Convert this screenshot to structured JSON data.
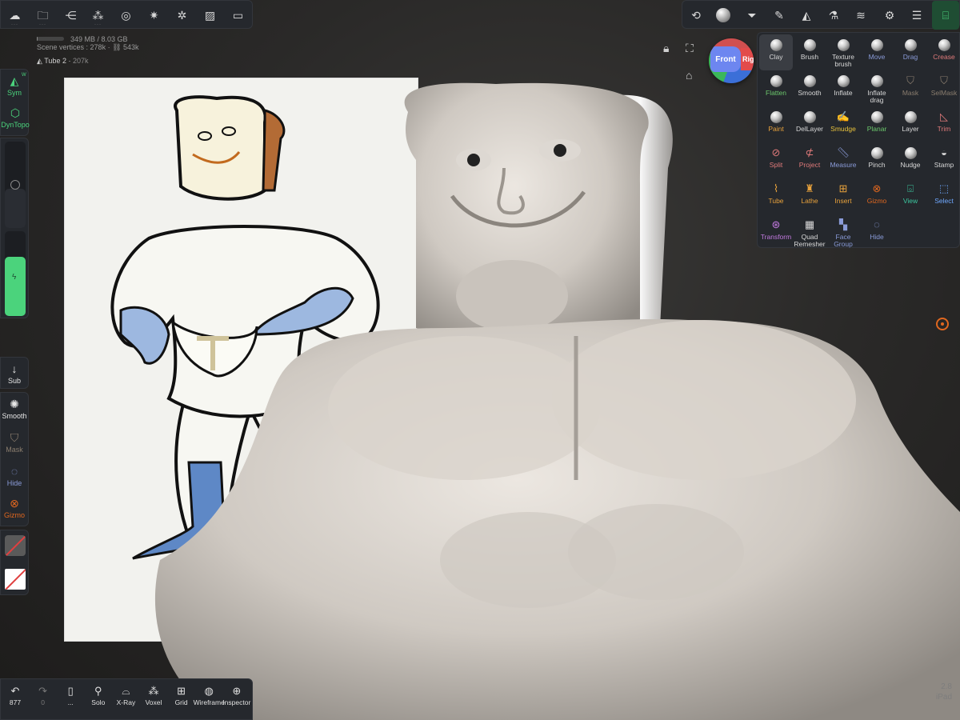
{
  "stats": {
    "memory": "349 MB / 8.03 GB",
    "memory_fraction": 0.04,
    "scene_vertices_label": "Scene vertices :",
    "scene_vertices": "278k",
    "scene_triangles": "543k",
    "object_name": "Tube 2",
    "object_vertices": "207k"
  },
  "top_left_icons": [
    "sketchfab-icon",
    "folder-icon",
    "share-nodes-icon",
    "cubes-icon",
    "globe-icon",
    "sun-icon",
    "aperture-icon",
    "image-icon",
    "camera-icon"
  ],
  "top_right_icons": [
    "cloud-sync-icon",
    "material-sphere-icon",
    "funnel-icon",
    "pen-icon",
    "triangle-icon",
    "flask-icon",
    "layers-icon",
    "settings-icon",
    "sliders-icon",
    "scene-tree-icon"
  ],
  "view_cube": {
    "front": "Front",
    "right": "Rig"
  },
  "tools": [
    {
      "label": "Clay",
      "icon": "ball",
      "color": "#d8d8d8",
      "selected": true
    },
    {
      "label": "Brush",
      "icon": "ball",
      "color": "#d8d8d8"
    },
    {
      "label": "Texture brush",
      "icon": "ball",
      "color": "#d8d8d8"
    },
    {
      "label": "Move",
      "icon": "ball",
      "color": "#8a9bd8"
    },
    {
      "label": "Drag",
      "icon": "ball",
      "color": "#8a9bd8"
    },
    {
      "label": "Crease",
      "icon": "ball",
      "color": "#e07a7a"
    },
    {
      "label": "Flatten",
      "icon": "ball",
      "color": "#6cc86c"
    },
    {
      "label": "Smooth",
      "icon": "ball",
      "color": "#d8d8d8"
    },
    {
      "label": "Inflate",
      "icon": "ball",
      "color": "#d8d8d8"
    },
    {
      "label": "Inflate drag",
      "icon": "ball",
      "color": "#d8d8d8"
    },
    {
      "label": "Mask",
      "icon": "shield",
      "color": "#8a7d6e"
    },
    {
      "label": "SelMask",
      "icon": "shield",
      "color": "#8a7d6e"
    },
    {
      "label": "Paint",
      "icon": "ball",
      "color": "#e8a23c"
    },
    {
      "label": "DelLayer",
      "icon": "ball",
      "color": "#d8d8d8"
    },
    {
      "label": "Smudge",
      "icon": "smudge",
      "color": "#e8c23c"
    },
    {
      "label": "Planar",
      "icon": "ball",
      "color": "#6cc86c"
    },
    {
      "label": "Layer",
      "icon": "ball",
      "color": "#d8d8d8"
    },
    {
      "label": "Trim",
      "icon": "trim",
      "color": "#e07a7a"
    },
    {
      "label": "Split",
      "icon": "split",
      "color": "#e07a7a"
    },
    {
      "label": "Project",
      "icon": "project",
      "color": "#e07a7a"
    },
    {
      "label": "Measure",
      "icon": "ruler",
      "color": "#8a9bd8"
    },
    {
      "label": "Pinch",
      "icon": "ball",
      "color": "#d8d8d8"
    },
    {
      "label": "Nudge",
      "icon": "ball",
      "color": "#d8d8d8"
    },
    {
      "label": "Stamp",
      "icon": "stamp",
      "color": "#d8d8d8"
    },
    {
      "label": "Tube",
      "icon": "tube",
      "color": "#e8a23c"
    },
    {
      "label": "Lathe",
      "icon": "lathe",
      "color": "#e8a23c"
    },
    {
      "label": "Insert",
      "icon": "insert",
      "color": "#e8a23c"
    },
    {
      "label": "Gizmo",
      "icon": "gizmo",
      "color": "#e0671f"
    },
    {
      "label": "View",
      "icon": "camera",
      "color": "#3cc8a0"
    },
    {
      "label": "Select",
      "icon": "select",
      "color": "#6fa8ff"
    },
    {
      "label": "Transform",
      "icon": "transform",
      "color": "#c37ae0"
    },
    {
      "label": "Quad Remesher",
      "icon": "grid",
      "color": "#d8d8d8"
    },
    {
      "label": "Face Group",
      "icon": "facegroup",
      "color": "#8a9bd8"
    },
    {
      "label": "Hide",
      "icon": "hide",
      "color": "#8a9bd8"
    }
  ],
  "left": {
    "sym": "Sym",
    "sym_badge": "W",
    "dyntopo": "DynTopo",
    "sub": "Sub",
    "smooth": "Smooth",
    "mask": "Mask",
    "hide": "Hide",
    "gizmo": "Gizmo",
    "radius_fraction": 0.45,
    "intensity_fraction": 0.7
  },
  "bottom": [
    {
      "label": "877",
      "icon": "undo-icon",
      "glyph": "↶"
    },
    {
      "label": "0",
      "icon": "redo-icon",
      "glyph": "↷"
    },
    {
      "label": "...",
      "icon": "phone-icon",
      "glyph": "▯"
    },
    {
      "label": "Solo",
      "icon": "magnifier-icon",
      "glyph": "⚲"
    },
    {
      "label": "X-Ray",
      "icon": "glasses-icon",
      "glyph": "⌓"
    },
    {
      "label": "Voxel",
      "icon": "voxel-icon",
      "glyph": "⁂"
    },
    {
      "label": "Grid",
      "icon": "grid-plane-icon",
      "glyph": "⊞"
    },
    {
      "label": "Wireframe",
      "icon": "wireframe-icon",
      "glyph": "◍"
    },
    {
      "label": "Inspector",
      "icon": "inspector-icon",
      "glyph": "⊕"
    }
  ],
  "corner": {
    "version": "2.8",
    "device": "iPad"
  },
  "colors": {
    "accent_green": "#4bd37c",
    "panel": "#25282d",
    "orbit": "#e0671f"
  }
}
